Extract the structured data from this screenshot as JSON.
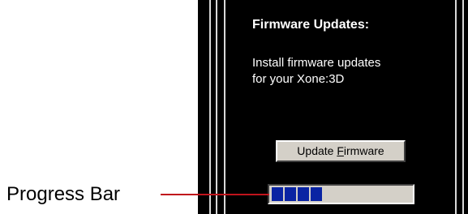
{
  "panel": {
    "title": "Firmware Updates:",
    "description_line1": "Install firmware updates",
    "description_line2": "for your Xone:3D"
  },
  "update_button": {
    "label_pre": "Update ",
    "label_access_key": "F",
    "label_post": "irmware"
  },
  "progress": {
    "segments_filled": 4,
    "fraction": 0.3
  },
  "annotation": {
    "caption": "Progress Bar",
    "leader_color": "#c0141c"
  },
  "colors": {
    "panel_background": "#000000",
    "progress_segment": "#0a24a3",
    "button_face": "#d4d0c8"
  }
}
